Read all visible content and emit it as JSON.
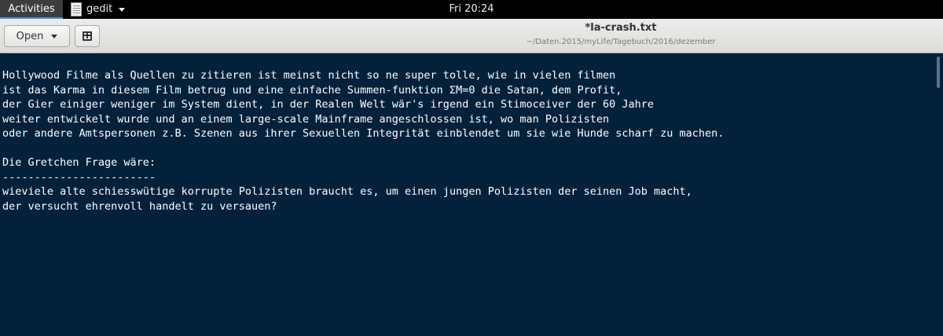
{
  "topbar": {
    "activities": "Activities",
    "app_name": "gedit",
    "clock": "Fri 20:24"
  },
  "header": {
    "open_label": "Open",
    "title": "*la-crash.txt",
    "path": "~/Daten.2015/myLife/Tagebuch/2016/dezember"
  },
  "editor": {
    "lines": [
      "Hollywood Filme als Quellen zu zitieren ist meinst nicht so ne super tolle, wie in vielen filmen",
      "ist das Karma in diesem Film betrug und eine einfache Summen-funktion ΣM=0 die Satan, dem Profit,",
      "der Gier einiger weniger im System dient, in der Realen Welt wär's irgend ein Stimoceiver der 60 Jahre",
      "weiter entwickelt wurde und an einem large-scale Mainframe angeschlossen ist, wo man Polizisten",
      "oder andere Amtspersonen z.B. Szenen aus ihrer Sexuellen Integrität einblendet um sie wie Hunde scharf zu machen.",
      "",
      "Die Gretchen Frage wäre:",
      "------------------------",
      "wieviele alte schiesswütige korrupte Polizisten braucht es, um einen jungen Polizisten der seinen Job macht,",
      "der versucht ehrenvoll handelt zu versauen?"
    ]
  }
}
